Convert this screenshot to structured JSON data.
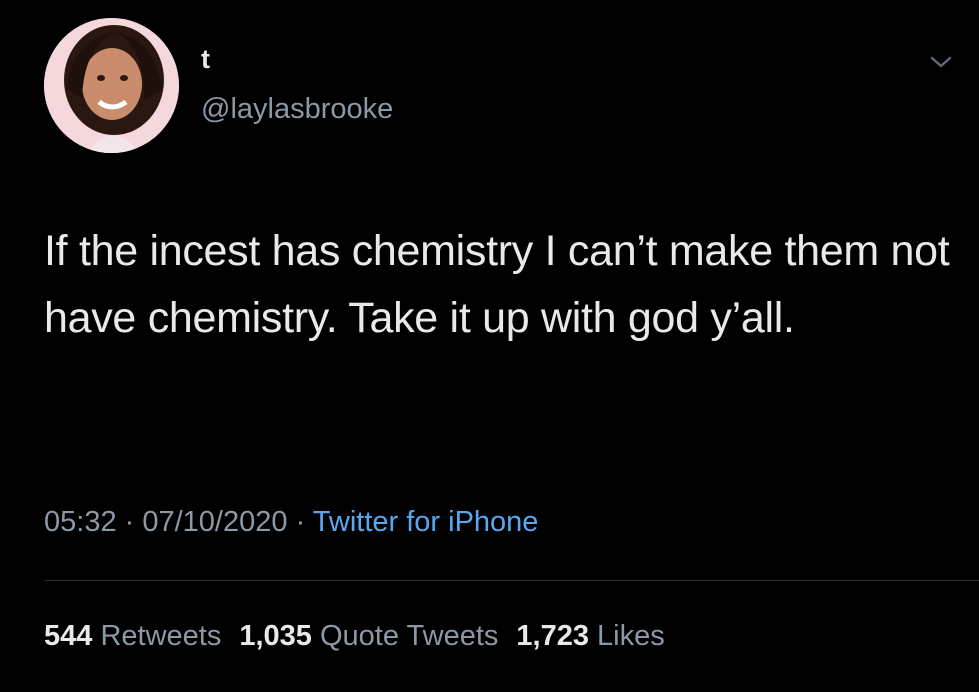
{
  "user": {
    "display_name": "t",
    "handle": "@laylasbrooke"
  },
  "tweet": {
    "text": "If the incest has chemistry I can’t make them not have chemistry. Take it up with god y’all.",
    "time": "05:32",
    "date": "07/10/2020",
    "separator": " · ",
    "source": "Twitter for iPhone"
  },
  "stats": {
    "retweets_count": "544",
    "retweets_label": "Retweets",
    "quotes_count": "1,035",
    "quotes_label": "Quote Tweets",
    "likes_count": "1,723",
    "likes_label": "Likes"
  },
  "icons": {
    "menu": "chevron-down-icon"
  },
  "colors": {
    "background": "#000000",
    "text_primary": "#e7e9ea",
    "text_muted": "#8b98a5",
    "link": "#5aa7ee"
  }
}
